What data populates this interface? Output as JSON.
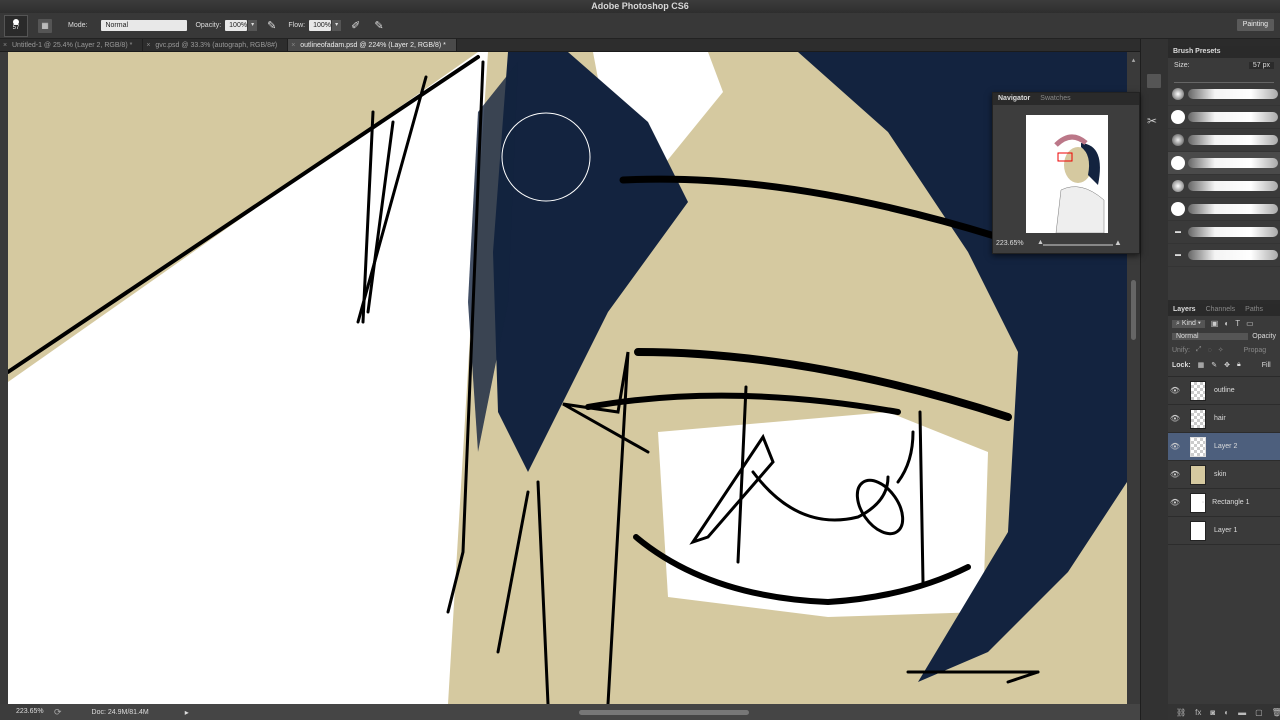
{
  "app": {
    "title": "Adobe Photoshop CS6"
  },
  "options": {
    "brush_size": "57",
    "mode_label": "Mode:",
    "mode_value": "Normal",
    "opacity_label": "Opacity:",
    "opacity_value": "100%",
    "flow_label": "Flow:",
    "flow_value": "100%",
    "workspace": "Painting"
  },
  "tabs": [
    {
      "label": "Untitled-1 @ 25.4% (Layer 2, RGB/8) *"
    },
    {
      "label": "gvc.psd @ 33.3% (autograph, RGB/8#)"
    },
    {
      "label": "outlineofadam.psd @ 224% (Layer 2, RGB/8) *"
    }
  ],
  "status": {
    "zoom": "223.65%",
    "doc": "Doc: 24.9M/81.4M"
  },
  "navigator": {
    "tab1": "Navigator",
    "tab2": "Swatches",
    "zoom": "223.65%"
  },
  "brush_presets": {
    "title": "Brush Presets",
    "size_label": "Size:",
    "size_value": "57 px"
  },
  "layers_panel": {
    "tab1": "Layers",
    "tab2": "Channels",
    "tab3": "Paths",
    "kind": "Kind",
    "blend": "Normal",
    "opacity_label": "Opacity",
    "unify_label": "Unify:",
    "propagate": "Propag",
    "lock_label": "Lock:",
    "fill_label": "Fill",
    "layers": [
      {
        "name": "outline",
        "visible": true
      },
      {
        "name": "hair",
        "visible": true
      },
      {
        "name": "Layer 2",
        "visible": true,
        "active": true
      },
      {
        "name": "skin",
        "visible": true
      },
      {
        "name": "Rectangle 1",
        "visible": true
      },
      {
        "name": "Layer 1",
        "visible": false
      }
    ]
  },
  "colors": {
    "skin": "#d5c9a0",
    "hair": "#13233f",
    "ui_dark": "#2b2b2b",
    "selected_layer": "#4d5f7d"
  }
}
